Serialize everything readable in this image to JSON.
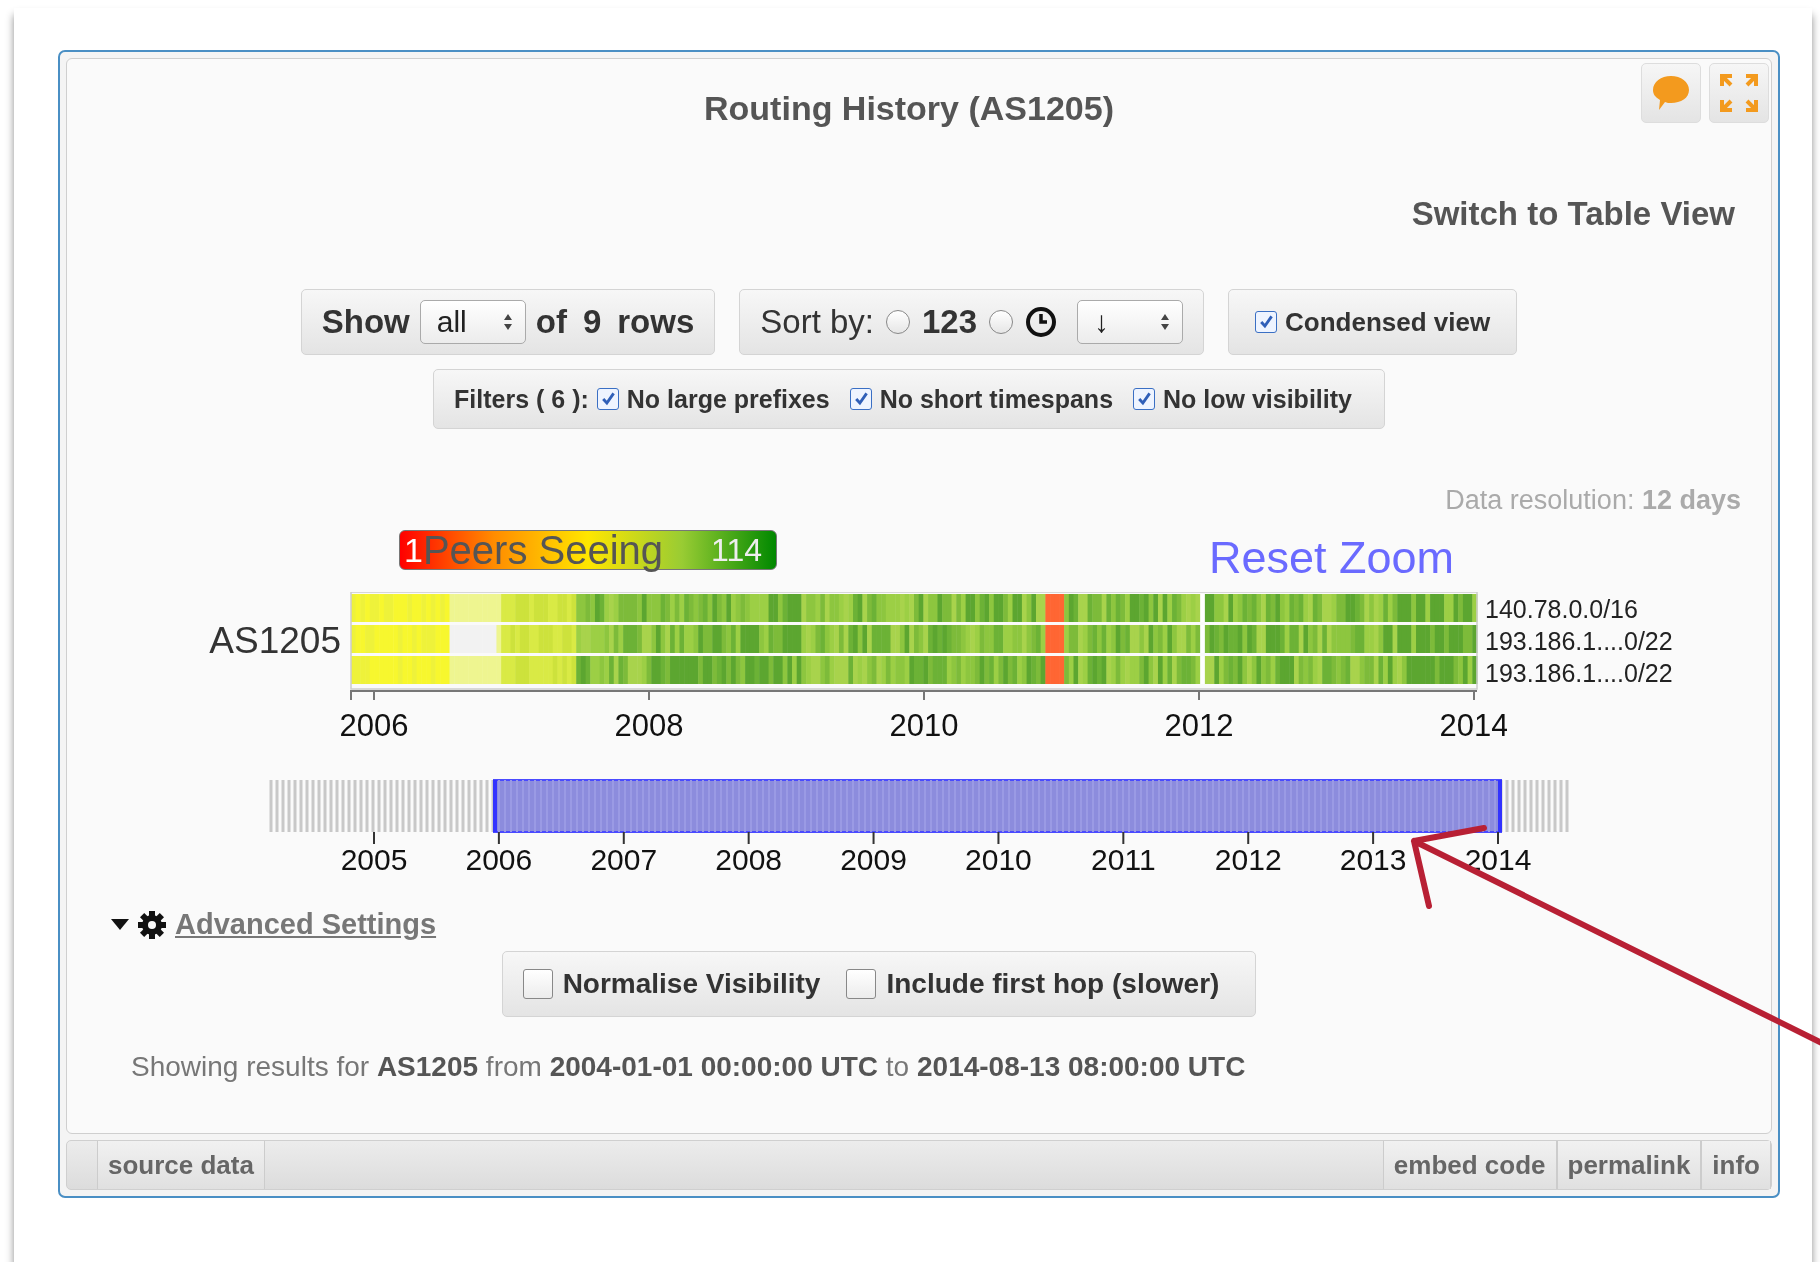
{
  "widget": {
    "title": "Routing History (AS1205)"
  },
  "view_switch": "Switch to Table View",
  "show": {
    "label": "Show",
    "value": "all",
    "of": "of",
    "count": "9",
    "rows": "rows"
  },
  "sort": {
    "label": "Sort by:",
    "options": [
      {
        "kind": "text",
        "label": "123",
        "selected": false
      },
      {
        "kind": "clock",
        "selected": false
      }
    ],
    "direction": "↓"
  },
  "condensed": {
    "label": "Condensed view",
    "checked": true
  },
  "filters": {
    "label": "Filters ( 6 ):",
    "items": [
      {
        "label": "No large prefixes",
        "checked": true
      },
      {
        "label": "No short timespans",
        "checked": true
      },
      {
        "label": "No low visibility",
        "checked": true
      }
    ]
  },
  "resolution": {
    "label": "Data resolution:",
    "value": "12 days"
  },
  "legend": {
    "min": "1",
    "title": "Peers Seeing",
    "max": "114"
  },
  "reset_zoom": "Reset Zoom",
  "heatmap": {
    "group": "AS1205",
    "rows": [
      {
        "prefix": "140.78.0.0/16"
      },
      {
        "prefix": "193.186.1....0/22"
      },
      {
        "prefix": "193.186.1....0/22"
      }
    ],
    "xticks": [
      "2006",
      "2008",
      "2010",
      "2012",
      "2014"
    ]
  },
  "navigator": {
    "ticks": [
      "2005",
      "2006",
      "2007",
      "2008",
      "2009",
      "2010",
      "2011",
      "2012",
      "2013",
      "2014"
    ]
  },
  "advanced": {
    "label": "Advanced Settings",
    "expanded": true,
    "options": [
      {
        "label": "Normalise Visibility",
        "checked": false
      },
      {
        "label": "Include first hop (slower)",
        "checked": false
      }
    ]
  },
  "summary": "Showing results for **AS1205** from **2004-01-01 00:00:00 UTC** to **2014-08-13 08:00:00 UTC**",
  "footer": {
    "left": [
      "source data"
    ],
    "right": [
      "embed code",
      "permalink",
      "info"
    ]
  }
}
